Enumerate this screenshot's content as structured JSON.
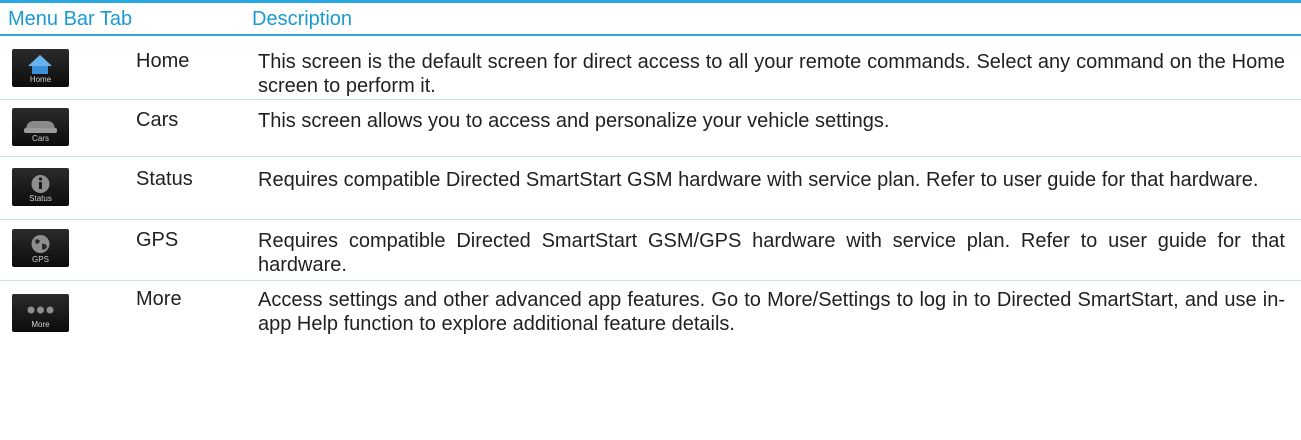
{
  "table": {
    "header": {
      "tab_label": "Menu Bar Tab",
      "description_label": "Description"
    },
    "rows": [
      {
        "icon": "home-icon",
        "icon_caption": "Home",
        "name": "Home",
        "description": "This screen is the default screen for direct access to all your remote commands. Select any command on the Home screen to perform it."
      },
      {
        "icon": "car-icon",
        "icon_caption": "Cars",
        "name": "Cars",
        "description": "This screen allows you to access and personalize your vehicle settings."
      },
      {
        "icon": "info-icon",
        "icon_caption": "Status",
        "name": "Status",
        "description": "Requires compatible Directed SmartStart GSM hardware with service plan. Refer to user guide for that hardware."
      },
      {
        "icon": "globe-icon",
        "icon_caption": "GPS",
        "name": "GPS",
        "description": "Requires compatible Directed SmartStart GSM/GPS hardware with service plan. Refer to user guide for that hardware."
      },
      {
        "icon": "more-dots-icon",
        "icon_caption": "More",
        "name": "More",
        "description": "Access settings and other advanced app features. Go to More/Settings to log in to Directed SmartStart, and use in-app Help function to explore additional feature details."
      }
    ]
  },
  "colors": {
    "header_text": "#1a9ad6",
    "rule": "#2aa9e0",
    "row_rule": "#bfe3f4",
    "body_text": "#231f20",
    "icon_bg": "#111111",
    "icon_accent": "#3d8fd6"
  }
}
